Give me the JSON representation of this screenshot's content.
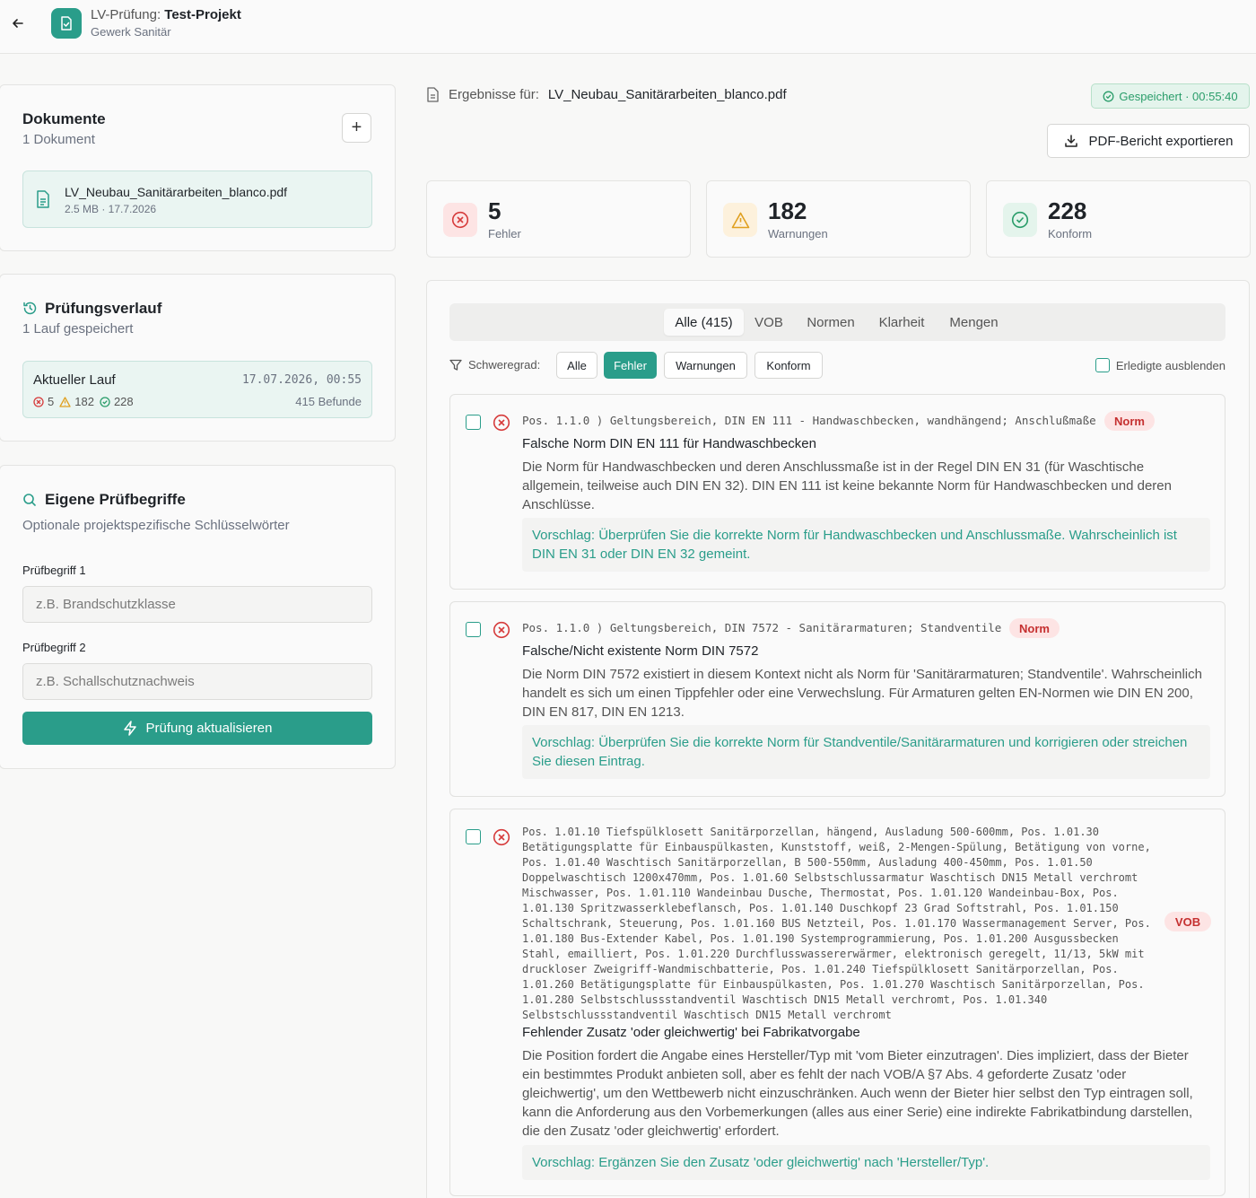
{
  "header": {
    "title_prefix": "LV-Prüfung:",
    "title_project": "Test-Projekt",
    "subtitle": "Gewerk Sanitär"
  },
  "documents": {
    "title": "Dokumente",
    "count": "1 Dokument",
    "add_label": "+",
    "file_name": "LV_Neubau_Sanitärarbeiten_blanco.pdf",
    "file_meta": "2.5 MB · 17.7.2026"
  },
  "history": {
    "title": "Prüfungsverlauf",
    "subtitle": "1 Lauf gespeichert",
    "run_title": "Aktueller Lauf",
    "run_date": "17.07.2026, 00:55",
    "run_errors": "5",
    "run_warnings": "182",
    "run_ok": "228",
    "run_findings": "415 Befunde"
  },
  "terms": {
    "title": "Eigene Prüfbegriffe",
    "subtitle": "Optionale projektspezifische Schlüsselwörter",
    "label1": "Prüfbegriff 1",
    "placeholder1": "z.B. Brandschutzklasse",
    "label2": "Prüfbegriff 2",
    "placeholder2": "z.B. Schallschutznachweis",
    "button": "Prüfung aktualisieren"
  },
  "results": {
    "label": "Ergebnisse für:",
    "file": "LV_Neubau_Sanitärarbeiten_blanco.pdf",
    "saved": "Gespeichert · 00:55:40",
    "export": "PDF-Bericht exportieren"
  },
  "stats": {
    "errors": "5",
    "errors_label": "Fehler",
    "warnings": "182",
    "warnings_label": "Warnungen",
    "ok": "228",
    "ok_label": "Konform"
  },
  "tabs": [
    "Alle (415)",
    "VOB",
    "Normen",
    "Klarheit",
    "Mengen"
  ],
  "filter": {
    "label": "Schweregrad:",
    "chips": [
      "Alle",
      "Fehler",
      "Warnungen",
      "Konform"
    ],
    "active": "Fehler",
    "hide_done": "Erledigte ausblenden"
  },
  "findings": [
    {
      "pos": "Pos. 1.1.0 ) Geltungsbereich, DIN EN 111 - Handwaschbecken, wandhängend; Anschlußmaße",
      "badge": "Norm",
      "title": "Falsche Norm DIN EN 111 für Handwaschbecken",
      "desc": "Die Norm für Handwaschbecken und deren Anschlussmaße ist in der Regel DIN EN 31 (für Waschtische allgemein, teilweise auch DIN EN 32). DIN EN 111 ist keine bekannte Norm für Handwaschbecken und deren Anschlüsse.",
      "sugg_label": "Vorschlag:",
      "sugg": "Überprüfen Sie die korrekte Norm für Handwaschbecken und Anschlussmaße. Wahrscheinlich ist DIN EN 31 oder DIN EN 32 gemeint."
    },
    {
      "pos": "Pos. 1.1.0 ) Geltungsbereich, DIN 7572 - Sanitärarmaturen; Standventile",
      "badge": "Norm",
      "title": "Falsche/Nicht existente Norm DIN 7572",
      "desc": "Die Norm DIN 7572 existiert in diesem Kontext nicht als Norm für 'Sanitärarmaturen; Standventile'. Wahrscheinlich handelt es sich um einen Tippfehler oder eine Verwechslung. Für Armaturen gelten EN-Normen wie DIN EN 200, DIN EN 817, DIN EN 1213.",
      "sugg_label": "Vorschlag:",
      "sugg": "Überprüfen Sie die korrekte Norm für Standventile/Sanitärarmaturen und korrigieren oder streichen Sie diesen Eintrag."
    },
    {
      "pos": "Pos. 1.01.10 Tiefspülklosett Sanitärporzellan, hängend, Ausladung 500-600mm, Pos. 1.01.30 Betätigungsplatte für Einbauspülkasten, Kunststoff, weiß, 2-Mengen-Spülung, Betätigung von vorne, Pos. 1.01.40 Waschtisch Sanitärporzellan, B 500-550mm, Ausladung 400-450mm, Pos. 1.01.50 Doppelwaschtisch 1200x470mm, Pos. 1.01.60 Selbstschlussarmatur Waschtisch DN15 Metall verchromt Mischwasser, Pos. 1.01.110 Wandeinbau Dusche, Thermostat, Pos. 1.01.120 Wandeinbau-Box, Pos. 1.01.130 Spritzwasserklebeflansch, Pos. 1.01.140 Duschkopf 23 Grad Softstrahl, Pos. 1.01.150 Schaltschrank, Steuerung, Pos. 1.01.160 BUS Netzteil, Pos. 1.01.170 Wassermanagement Server, Pos. 1.01.180 Bus-Extender Kabel, Pos. 1.01.190 Systemprogrammierung, Pos. 1.01.200 Ausgussbecken Stahl, emailliert, Pos. 1.01.220 Durchflusswassererwärmer, elektronisch geregelt, 11/13, 5kW mit druckloser Zweigriff-Wandmischbatterie, Pos. 1.01.240 Tiefspülklosett Sanitärporzellan, Pos. 1.01.260 Betätigungsplatte für Einbauspülkasten, Pos. 1.01.270 Waschtisch Sanitärporzellan, Pos. 1.01.280 Selbstschlussstandventil Waschtisch DN15 Metall verchromt, Pos. 1.01.340 Selbstschlussstandventil Waschtisch DN15 Metall verchromt",
      "badge": "VOB",
      "title": "Fehlender Zusatz 'oder gleichwertig' bei Fabrikatvorgabe",
      "desc": "Die Position fordert die Angabe eines Hersteller/Typ mit 'vom Bieter einzutragen'. Dies impliziert, dass der Bieter ein bestimmtes Produkt anbieten soll, aber es fehlt der nach VOB/A §7 Abs. 4 geforderte Zusatz 'oder gleichwertig', um den Wettbewerb nicht einzuschränken. Auch wenn der Bieter hier selbst den Typ eintragen soll, kann die Anforderung aus den Vorbemerkungen (alles aus einer Serie) eine indirekte Fabrikatbindung darstellen, die den Zusatz 'oder gleichwertig' erfordert.",
      "sugg_label": "Vorschlag:",
      "sugg": "Ergänzen Sie den Zusatz 'oder gleichwertig' nach 'Hersteller/Typ'."
    }
  ]
}
